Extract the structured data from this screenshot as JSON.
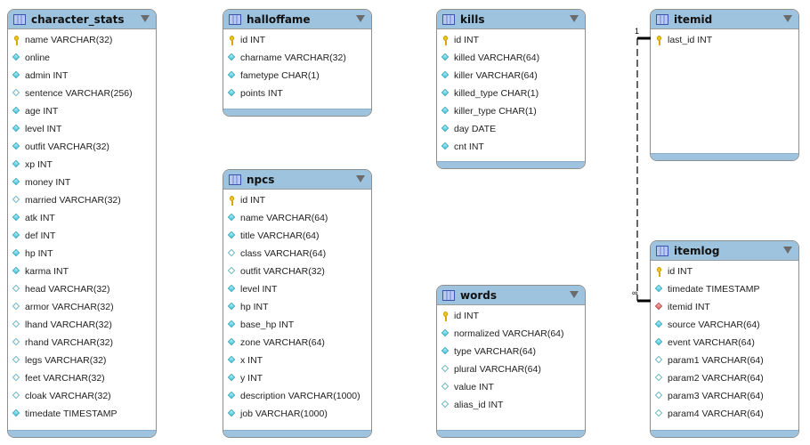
{
  "diagram": {
    "tables": [
      {
        "name": "character_stats",
        "columns": [
          {
            "label": "name VARCHAR(32)",
            "kind": "pk"
          },
          {
            "label": "online",
            "kind": "nn"
          },
          {
            "label": "admin INT",
            "kind": "nn"
          },
          {
            "label": "sentence VARCHAR(256)",
            "kind": "null"
          },
          {
            "label": "age INT",
            "kind": "nn"
          },
          {
            "label": "level INT",
            "kind": "nn"
          },
          {
            "label": "outfit VARCHAR(32)",
            "kind": "nn"
          },
          {
            "label": "xp INT",
            "kind": "nn"
          },
          {
            "label": "money INT",
            "kind": "nn"
          },
          {
            "label": "married VARCHAR(32)",
            "kind": "null"
          },
          {
            "label": "atk INT",
            "kind": "nn"
          },
          {
            "label": "def INT",
            "kind": "nn"
          },
          {
            "label": "hp INT",
            "kind": "nn"
          },
          {
            "label": "karma INT",
            "kind": "nn"
          },
          {
            "label": "head VARCHAR(32)",
            "kind": "null"
          },
          {
            "label": "armor VARCHAR(32)",
            "kind": "null"
          },
          {
            "label": "lhand VARCHAR(32)",
            "kind": "null"
          },
          {
            "label": "rhand VARCHAR(32)",
            "kind": "null"
          },
          {
            "label": "legs VARCHAR(32)",
            "kind": "null"
          },
          {
            "label": "feet VARCHAR(32)",
            "kind": "null"
          },
          {
            "label": "cloak VARCHAR(32)",
            "kind": "null"
          },
          {
            "label": "timedate TIMESTAMP",
            "kind": "nn"
          }
        ]
      },
      {
        "name": "halloffame",
        "columns": [
          {
            "label": "id INT",
            "kind": "pk"
          },
          {
            "label": "charname VARCHAR(32)",
            "kind": "nn"
          },
          {
            "label": "fametype CHAR(1)",
            "kind": "nn"
          },
          {
            "label": "points INT",
            "kind": "nn"
          }
        ]
      },
      {
        "name": "npcs",
        "columns": [
          {
            "label": "id INT",
            "kind": "pk"
          },
          {
            "label": "name VARCHAR(64)",
            "kind": "nn"
          },
          {
            "label": "title VARCHAR(64)",
            "kind": "nn"
          },
          {
            "label": "class VARCHAR(64)",
            "kind": "null"
          },
          {
            "label": "outfit VARCHAR(32)",
            "kind": "null"
          },
          {
            "label": "level INT",
            "kind": "nn"
          },
          {
            "label": "hp INT",
            "kind": "nn"
          },
          {
            "label": "base_hp INT",
            "kind": "nn"
          },
          {
            "label": "zone VARCHAR(64)",
            "kind": "nn"
          },
          {
            "label": "x INT",
            "kind": "nn"
          },
          {
            "label": "y INT",
            "kind": "nn"
          },
          {
            "label": "description VARCHAR(1000)",
            "kind": "nn"
          },
          {
            "label": "job VARCHAR(1000)",
            "kind": "nn"
          }
        ]
      },
      {
        "name": "kills",
        "columns": [
          {
            "label": "id INT",
            "kind": "pk"
          },
          {
            "label": "killed VARCHAR(64)",
            "kind": "nn"
          },
          {
            "label": "killer VARCHAR(64)",
            "kind": "nn"
          },
          {
            "label": "killed_type CHAR(1)",
            "kind": "nn"
          },
          {
            "label": "killer_type CHAR(1)",
            "kind": "nn"
          },
          {
            "label": "day DATE",
            "kind": "nn"
          },
          {
            "label": "cnt INT",
            "kind": "nn"
          }
        ]
      },
      {
        "name": "words",
        "columns": [
          {
            "label": "id INT",
            "kind": "pk"
          },
          {
            "label": "normalized VARCHAR(64)",
            "kind": "nn"
          },
          {
            "label": "type VARCHAR(64)",
            "kind": "nn"
          },
          {
            "label": "plural VARCHAR(64)",
            "kind": "null"
          },
          {
            "label": "value INT",
            "kind": "null"
          },
          {
            "label": "alias_id INT",
            "kind": "null"
          }
        ]
      },
      {
        "name": "itemid",
        "columns": [
          {
            "label": "last_id INT",
            "kind": "pk"
          }
        ]
      },
      {
        "name": "itemlog",
        "columns": [
          {
            "label": "id INT",
            "kind": "pk"
          },
          {
            "label": "timedate TIMESTAMP",
            "kind": "nn"
          },
          {
            "label": "itemid INT",
            "kind": "fk"
          },
          {
            "label": "source VARCHAR(64)",
            "kind": "nn"
          },
          {
            "label": "event VARCHAR(64)",
            "kind": "nn"
          },
          {
            "label": "param1 VARCHAR(64)",
            "kind": "null"
          },
          {
            "label": "param2 VARCHAR(64)",
            "kind": "null"
          },
          {
            "label": "param3 VARCHAR(64)",
            "kind": "null"
          },
          {
            "label": "param4 VARCHAR(64)",
            "kind": "null"
          }
        ]
      }
    ],
    "relationships": [
      {
        "from": "itemlog.itemid",
        "to": "itemid.last_id",
        "one_label": "1",
        "many_label": "∞"
      }
    ]
  }
}
